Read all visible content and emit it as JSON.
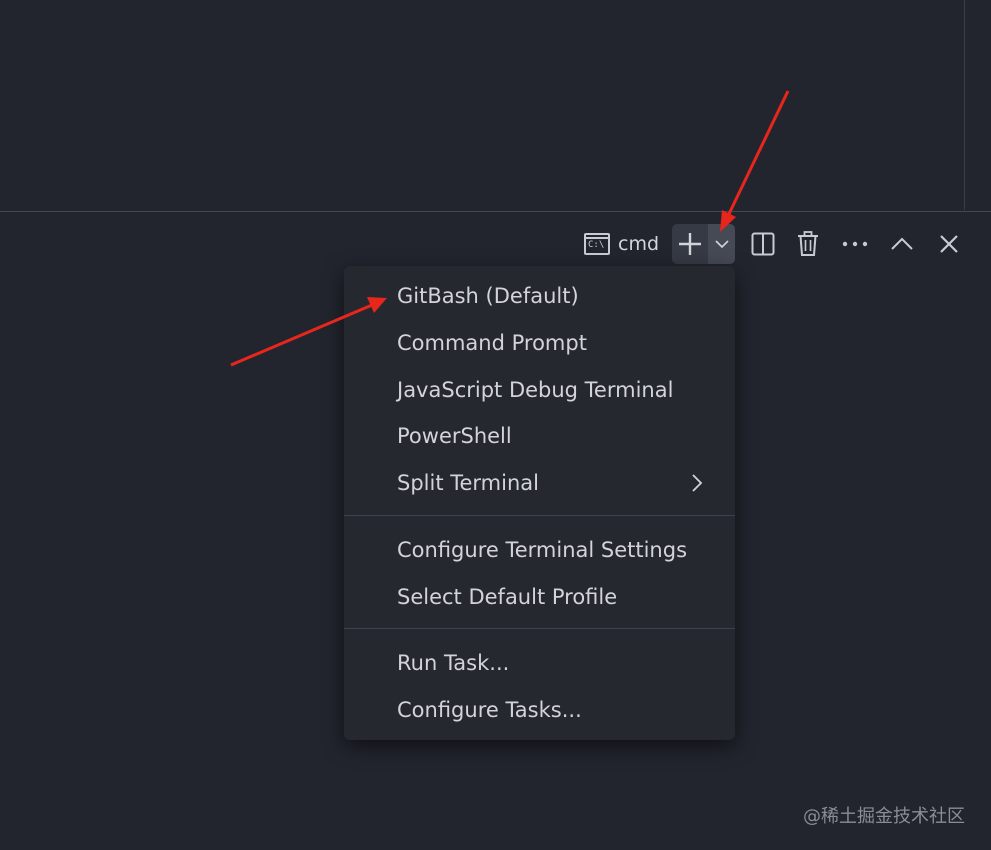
{
  "terminal_toolbar": {
    "terminal_name": "cmd",
    "terminal_icon": "cmd-terminal-icon",
    "cmd_icon_text": "C:\\",
    "actions": [
      {
        "name": "new-terminal-button",
        "icon": "plus-icon"
      },
      {
        "name": "launch-profile-dropdown",
        "icon": "chevron-down-icon"
      },
      {
        "name": "split-terminal-button",
        "icon": "split-icon"
      },
      {
        "name": "kill-terminal-button",
        "icon": "trash-icon"
      },
      {
        "name": "more-actions-button",
        "icon": "ellipsis-icon"
      },
      {
        "name": "maximize-panel-button",
        "icon": "chevron-up-icon"
      },
      {
        "name": "close-panel-button",
        "icon": "close-icon"
      }
    ]
  },
  "profile_menu": {
    "profiles": [
      {
        "label": "GitBash (Default)"
      },
      {
        "label": "Command Prompt"
      },
      {
        "label": "JavaScript Debug Terminal"
      },
      {
        "label": "PowerShell"
      },
      {
        "label": "Split Terminal",
        "has_submenu": true
      }
    ],
    "settings": [
      {
        "label": "Configure Terminal Settings"
      },
      {
        "label": "Select Default Profile"
      }
    ],
    "tasks": [
      {
        "label": "Run Task..."
      },
      {
        "label": "Configure Tasks..."
      }
    ]
  },
  "watermark": "@稀土掘金技术社区",
  "colors": {
    "background": "#22252e",
    "menu_background": "#262830",
    "text": "#d2d4da",
    "annotation_arrow": "#e8261c"
  }
}
